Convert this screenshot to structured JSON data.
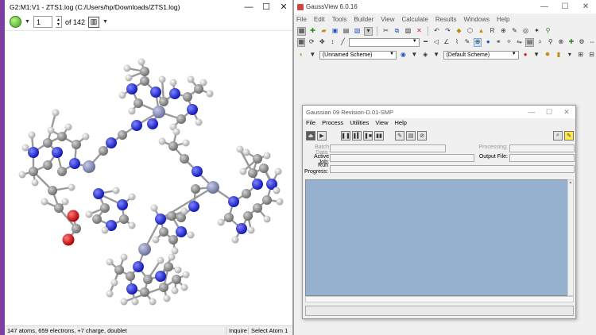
{
  "viewer": {
    "title": "G2:M1:V1 - ZTS1.log (C:/Users/hp/Downloads/ZTS1.log)",
    "frame_value": "1",
    "frame_total": "of 142",
    "status_main": "147 atoms, 659 electrons, +7 charge, doublet",
    "status_mode": "Inquire",
    "status_select": "Select Atom 1",
    "window_controls": {
      "minimize": "—",
      "maximize": "☐",
      "close": "✕"
    }
  },
  "gaussview": {
    "title": "GaussView 6.0.16",
    "menu": [
      "File",
      "Edit",
      "Tools",
      "Builder",
      "View",
      "Calculate",
      "Results",
      "Windows",
      "Help"
    ],
    "unnamed_scheme": "(Unnamed Scheme)",
    "default_scheme": "(Default Scheme)",
    "window_controls": {
      "minimize": "—",
      "maximize": "☐",
      "close": "✕"
    }
  },
  "g09": {
    "title": "Gaussian 09 Revision-D.01-SMP",
    "menu": [
      "File",
      "Process",
      "Utilities",
      "View",
      "Help"
    ],
    "labels": {
      "batch_data": "Batch Data:",
      "processing": "Processing:",
      "active_job": "Active Job:",
      "output_file": "Output File:",
      "run_progress_1": "Run",
      "run_progress_2": "Progress:"
    },
    "window_controls": {
      "minimize": "—",
      "maximize": "☐",
      "close": "✕"
    }
  },
  "colors": {
    "viewer_edge": "#7b3fa0",
    "log_panel": "#96b0cf",
    "atom_nitrogen": "#1f25d6",
    "atom_carbon": "#8f8f8f",
    "atom_hydrogen": "#e8e8e8",
    "atom_oxygen": "#e01010",
    "atom_metal": "#8e93bd"
  }
}
